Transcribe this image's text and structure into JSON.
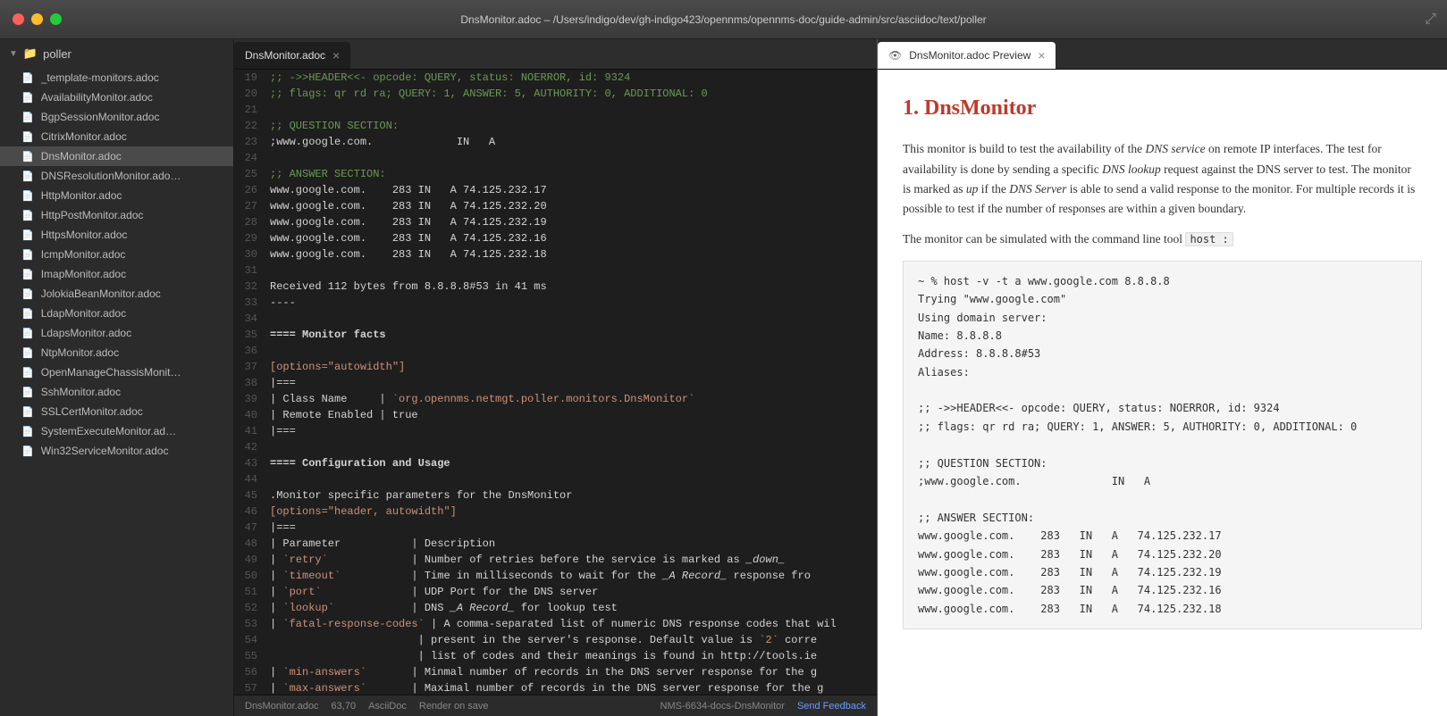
{
  "titlebar": {
    "title": "DnsMonitor.adoc – /Users/indigo/dev/gh-indigo423/opennms/opennms-doc/guide-admin/src/asciidoc/text/poller",
    "buttons": {
      "close": "close",
      "minimize": "minimize",
      "maximize": "maximize"
    }
  },
  "sidebar": {
    "folder_label": "poller",
    "items": [
      {
        "name": "_template-monitors.adoc",
        "active": false
      },
      {
        "name": "AvailabilityMonitor.adoc",
        "active": false
      },
      {
        "name": "BgpSessionMonitor.adoc",
        "active": false
      },
      {
        "name": "CitrixMonitor.adoc",
        "active": false
      },
      {
        "name": "DnsMonitor.adoc",
        "active": true
      },
      {
        "name": "DNSResolutionMonitor.ado…",
        "active": false
      },
      {
        "name": "HttpMonitor.adoc",
        "active": false
      },
      {
        "name": "HttpPostMonitor.adoc",
        "active": false
      },
      {
        "name": "HttpsMonitor.adoc",
        "active": false
      },
      {
        "name": "IcmpMonitor.adoc",
        "active": false
      },
      {
        "name": "ImapMonitor.adoc",
        "active": false
      },
      {
        "name": "JolokiaBeanMonitor.adoc",
        "active": false
      },
      {
        "name": "LdapMonitor.adoc",
        "active": false
      },
      {
        "name": "LdapsMonitor.adoc",
        "active": false
      },
      {
        "name": "NtpMonitor.adoc",
        "active": false
      },
      {
        "name": "OpenManageChassisMonit…",
        "active": false
      },
      {
        "name": "SshMonitor.adoc",
        "active": false
      },
      {
        "name": "SSLCertMonitor.adoc",
        "active": false
      },
      {
        "name": "SystemExecuteMonitor.ad…",
        "active": false
      },
      {
        "name": "Win32ServiceMonitor.adoc",
        "active": false
      }
    ]
  },
  "editor": {
    "tab_label": "DnsMonitor.adoc",
    "lines": [
      {
        "num": 19,
        "content": ";; ->>HEADER<<- opcode: QUERY, status: NOERROR, id: 9324"
      },
      {
        "num": 20,
        "content": ";; flags: qr rd ra; QUERY: 1, ANSWER: 5, AUTHORITY: 0, ADDITIONAL: 0"
      },
      {
        "num": 21,
        "content": ""
      },
      {
        "num": 22,
        "content": ";; QUESTION SECTION:"
      },
      {
        "num": 23,
        "content": ";www.google.com.             IN   A"
      },
      {
        "num": 24,
        "content": ""
      },
      {
        "num": 25,
        "content": ";; ANSWER SECTION:"
      },
      {
        "num": 26,
        "content": "www.google.com.    283 IN   A 74.125.232.17"
      },
      {
        "num": 27,
        "content": "www.google.com.    283 IN   A 74.125.232.20"
      },
      {
        "num": 28,
        "content": "www.google.com.    283 IN   A 74.125.232.19"
      },
      {
        "num": 29,
        "content": "www.google.com.    283 IN   A 74.125.232.16"
      },
      {
        "num": 30,
        "content": "www.google.com.    283 IN   A 74.125.232.18"
      },
      {
        "num": 31,
        "content": ""
      },
      {
        "num": 32,
        "content": "Received 112 bytes from 8.8.8.8#53 in 41 ms"
      },
      {
        "num": 33,
        "content": "----"
      },
      {
        "num": 34,
        "content": ""
      },
      {
        "num": 35,
        "content": "==== Monitor facts"
      },
      {
        "num": 36,
        "content": ""
      },
      {
        "num": 37,
        "content": "[options=\"autowidth\"]"
      },
      {
        "num": 38,
        "content": "|==="
      },
      {
        "num": 39,
        "content": "| Class Name     | `org.opennms.netmgt.poller.monitors.DnsMonitor`"
      },
      {
        "num": 40,
        "content": "| Remote Enabled | true"
      },
      {
        "num": 41,
        "content": "|==="
      },
      {
        "num": 42,
        "content": ""
      },
      {
        "num": 43,
        "content": "==== Configuration and Usage"
      },
      {
        "num": 44,
        "content": ""
      },
      {
        "num": 45,
        "content": ".Monitor specific parameters for the DnsMonitor"
      },
      {
        "num": 46,
        "content": "[options=\"header, autowidth\"]"
      },
      {
        "num": 47,
        "content": "|==="
      },
      {
        "num": 48,
        "content": "| Parameter           | Description"
      },
      {
        "num": 49,
        "content": "| `retry`             | Number of retries before the service is marked as _down_"
      },
      {
        "num": 50,
        "content": "| `timeout`           | Time in milliseconds to wait for the _A Record_ response fro"
      },
      {
        "num": 51,
        "content": "| `port`              | UDP Port for the DNS server"
      },
      {
        "num": 52,
        "content": "| `lookup`            | DNS _A Record_ for lookup test"
      },
      {
        "num": 53,
        "content": "| `fatal-response-codes` | A comma-separated list of numeric DNS response codes that wil"
      },
      {
        "num": 54,
        "content": "                       | present in the server's response. Default value is `2` corre"
      },
      {
        "num": 55,
        "content": "                       | list of codes and their meanings is found in http://tools.ie"
      },
      {
        "num": 56,
        "content": "| `min-answers`       | Minmal number of records in the DNS server response for the g"
      },
      {
        "num": 57,
        "content": "| `max-answers`       | Maximal number of records in the DNS server response for the g"
      },
      {
        "num": 58,
        "content": ""
      }
    ],
    "status": {
      "filename": "DnsMonitor.adoc",
      "position": "63,70",
      "type": "AsciiDoc",
      "render": "Render on save"
    }
  },
  "preview": {
    "tab_label": "DnsMonitor.adoc Preview",
    "h1": "1. DnsMonitor",
    "intro_p1": "This monitor is build to test the availability of the DNS service on remote IP interfaces. The test for availability is done by sending a specific DNS lookup request against the DNS server to test. The monitor is marked as up if the DNS Server is able to send a valid response to the monitor. For multiple records it is possible to test if the number of responses are within a given boundary.",
    "intro_p2": "The monitor can be simulated with the command line tool",
    "host_code": "host :",
    "code_block": "~ % host -v -t a www.google.com 8.8.8.8\nTrying \"www.google.com\"\nUsing domain server:\nName: 8.8.8.8\nAddress: 8.8.8.8#53\nAliases:\n\n;; ->>HEADER<<- opcode: QUERY, status: NOERROR, id: 9324\n;; flags: qr rd ra; QUERY: 1, ANSWER: 5, AUTHORITY: 0, ADDITIONAL: 0\n\n;; QUESTION SECTION:\n;www.google.com.              IN   A\n\n;; ANSWER SECTION:\nwww.google.com.    283   IN   A   74.125.232.17\nwww.google.com.    283   IN   A   74.125.232.20\nwww.google.com.    283   IN   A   74.125.232.19\nwww.google.com.    283   IN   A   74.125.232.16\nwww.google.com.    283   IN   A   74.125.232.18"
  },
  "statusbar": {
    "nms_label": "NMS-6634-docs-DnsMonitor",
    "feedback_label": "Send Feedback"
  }
}
